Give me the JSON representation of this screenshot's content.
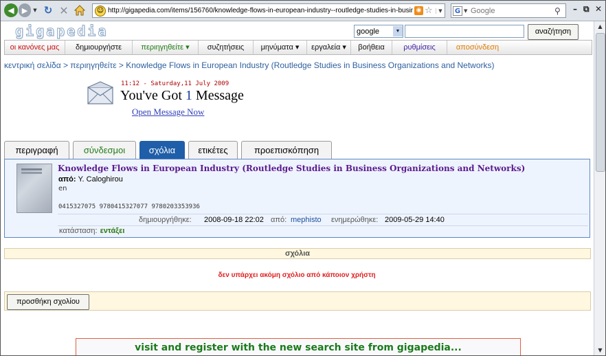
{
  "browser": {
    "url": "http://gigapedia.com/items/156760/knowledge-flows-in-european-industry--routledge-studies-in-business",
    "search_placeholder": "Google",
    "window_controls": [
      "–",
      "⧉",
      "✕"
    ]
  },
  "site": {
    "logo": "gigapedia",
    "search_select": "google",
    "search_button": "αναζήτηση"
  },
  "menu": [
    {
      "label": "οι κανόνες μας",
      "color": "#cc1111"
    },
    {
      "label": "δημιουργήστε",
      "color": "#111111"
    },
    {
      "label": "περιηγηθείτε ▾",
      "color": "#1f7a15"
    },
    {
      "label": "συζητήσεις",
      "color": "#111111"
    },
    {
      "label": "μηνύματα ▾",
      "color": "#111111"
    },
    {
      "label": "εργαλεία ▾",
      "color": "#111111"
    },
    {
      "label": "βοήθεια",
      "color": "#111111"
    },
    {
      "label": "ρυθμίσεις",
      "color": "#3b1fa0"
    },
    {
      "label": "αποσύνδεση",
      "color": "#e07a00"
    }
  ],
  "breadcrumb": "κεντρική σελίδα > περιηγηθείτε > Knowledge Flows in European Industry (Routledge Studies in Business Organizations and Networks)",
  "message": {
    "date": "11:12 - Saturday,11 July 2009",
    "title_before": "You've Got ",
    "count": "1",
    "title_after": " Message",
    "link": "Open Message Now"
  },
  "tabs": [
    {
      "label": "περιγραφή"
    },
    {
      "label": "σύνδεσμοι"
    },
    {
      "label": "σχόλια"
    },
    {
      "label": "ετικέτες"
    },
    {
      "label": "προεπισκόπηση"
    }
  ],
  "book": {
    "title": "Knowledge Flows in European Industry (Routledge Studies in Business Organizations and Networks)",
    "author_label": "από:",
    "author": "Y. Caloghirou",
    "language": "en",
    "isbns": "0415327075  9780415327077  9780203353936",
    "created_label": "δημιουργήθηκε:",
    "created": "2008-09-18 22:02",
    "by_label": "από:",
    "by": "mephisto",
    "updated_label": "ενημερώθηκε:",
    "updated": "2009-05-29 14:40",
    "status_label": "κατάσταση:",
    "status": "εντάξει"
  },
  "comments": {
    "header": "σχόλια",
    "empty": "δεν υπάρχει ακόμη σχόλιο από κάποιον χρήστη",
    "add_button": "προσθήκη σχολίου"
  },
  "banner": "visit and register with the new search site from gigapedia..."
}
